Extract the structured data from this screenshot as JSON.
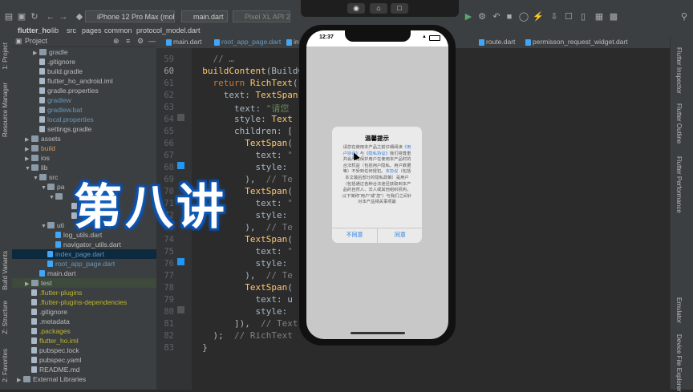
{
  "window": {
    "title": "flutte"
  },
  "toolbar": {
    "device_selector": "iPhone 12 Pro Max (mobile)",
    "run_config": "main.dart",
    "emulator": "Pixel XL API 27"
  },
  "breadcrumb": [
    "flutter_ho",
    "lib",
    "src",
    "pages",
    "common",
    "protocol_model.dart"
  ],
  "left_strip": {
    "project_tab": "1: Project",
    "resource_manager_tab": "Resource Manager",
    "build_variants_tab": "Build Variants",
    "structure_tab": "Z: Structure",
    "favorites_tab": "2: Favorites"
  },
  "project_panel": {
    "title": "Project",
    "rows": [
      {
        "label": "gradle",
        "type": "folder",
        "indent": 3,
        "arrow": "▶",
        "color": "#a9b7c6"
      },
      {
        "label": ".gitignore",
        "type": "file",
        "indent": 3,
        "arrow": "",
        "color": "#bbbbbb"
      },
      {
        "label": "build.gradle",
        "type": "file",
        "indent": 3,
        "arrow": "",
        "color": "#bbbbbb"
      },
      {
        "label": "flutter_ho_android.iml",
        "type": "file",
        "indent": 3,
        "arrow": "",
        "color": "#bbbbbb"
      },
      {
        "label": "gradle.properties",
        "type": "file",
        "indent": 3,
        "arrow": "",
        "color": "#bbbbbb"
      },
      {
        "label": "gradlew",
        "type": "file",
        "indent": 3,
        "arrow": "",
        "color": "#6897bb"
      },
      {
        "label": "gradlew.bat",
        "type": "file",
        "indent": 3,
        "arrow": "",
        "color": "#6897bb"
      },
      {
        "label": "local.properties",
        "type": "file",
        "indent": 3,
        "arrow": "",
        "color": "#6897bb"
      },
      {
        "label": "settings.gradle",
        "type": "file",
        "indent": 3,
        "arrow": "",
        "color": "#bbbbbb"
      },
      {
        "label": "assets",
        "type": "folder",
        "indent": 2,
        "arrow": "▶",
        "color": "#bbbbbb"
      },
      {
        "label": "build",
        "type": "folder",
        "indent": 2,
        "arrow": "▶",
        "color": "#d19a66"
      },
      {
        "label": "ios",
        "type": "folder",
        "indent": 2,
        "arrow": "▶",
        "color": "#bbbbbb"
      },
      {
        "label": "lib",
        "type": "folder",
        "indent": 2,
        "arrow": "▼",
        "color": "#bbbbbb"
      },
      {
        "label": "src",
        "type": "folder",
        "indent": 3,
        "arrow": "▼",
        "color": "#bbbbbb"
      },
      {
        "label": "pa",
        "type": "folder",
        "indent": 4,
        "arrow": "▼",
        "color": "#bbbbbb"
      },
      {
        "label": "",
        "type": "folder",
        "indent": 5,
        "arrow": "▼",
        "color": "#bbbbbb"
      },
      {
        "label": "ast",
        "type": "file",
        "indent": 7,
        "arrow": "",
        "color": "#bbbbbb"
      },
      {
        "label": "",
        "type": "file",
        "indent": 7,
        "arrow": "",
        "color": "#bbbbbb"
      },
      {
        "label": "uti",
        "type": "folder",
        "indent": 4,
        "arrow": "▼",
        "color": "#bbbbbb"
      },
      {
        "label": "log_utils.dart",
        "type": "dart",
        "indent": 5,
        "arrow": "",
        "color": "#bbbbbb"
      },
      {
        "label": "navigator_utils.dart",
        "type": "dart",
        "indent": 5,
        "arrow": "",
        "color": "#bbbbbb"
      },
      {
        "label": "index_page.dart",
        "type": "dart",
        "indent": 4,
        "arrow": "",
        "color": "#6897bb",
        "selected": true
      },
      {
        "label": "root_app_page.dart",
        "type": "dart",
        "indent": 4,
        "arrow": "",
        "color": "#6897bb"
      },
      {
        "label": "main.dart",
        "type": "dart",
        "indent": 3,
        "arrow": "",
        "color": "#bbbbbb"
      },
      {
        "label": "test",
        "type": "folder",
        "indent": 2,
        "arrow": "▶",
        "color": "#bbbbbb",
        "highlight": true
      },
      {
        "label": ".flutter-plugins",
        "type": "file",
        "indent": 2,
        "arrow": "",
        "color": "#bbb529"
      },
      {
        "label": ".flutter-plugins-dependencies",
        "type": "file",
        "indent": 2,
        "arrow": "",
        "color": "#bbb529"
      },
      {
        "label": ".gitignore",
        "type": "file",
        "indent": 2,
        "arrow": "",
        "color": "#bbbbbb"
      },
      {
        "label": ".metadata",
        "type": "file",
        "indent": 2,
        "arrow": "",
        "color": "#bbbbbb"
      },
      {
        "label": ".packages",
        "type": "file",
        "indent": 2,
        "arrow": "",
        "color": "#bbb529"
      },
      {
        "label": "flutter_ho.iml",
        "type": "file",
        "indent": 2,
        "arrow": "",
        "color": "#bbb529"
      },
      {
        "label": "pubspec.lock",
        "type": "file",
        "indent": 2,
        "arrow": "",
        "color": "#bbbbbb"
      },
      {
        "label": "pubspec.yaml",
        "type": "file",
        "indent": 2,
        "arrow": "",
        "color": "#bbbbbb"
      },
      {
        "label": "README.md",
        "type": "file",
        "indent": 2,
        "arrow": "",
        "color": "#bbbbbb"
      },
      {
        "label": "External Libraries",
        "type": "folder",
        "indent": 1,
        "arrow": "▶",
        "color": "#bbbbbb"
      }
    ]
  },
  "tabs": [
    "main.dart",
    "root_app_page.dart",
    "in",
    "route.dart",
    "permisson_request_widget.dart"
  ],
  "editor": {
    "line_numbers": [
      "59",
      "60",
      "61",
      "62",
      "63",
      "64",
      "65",
      "66",
      "67",
      "68",
      "69",
      "70",
      "71",
      "72",
      "73",
      "74",
      "75",
      "76",
      "77",
      "78",
      "79",
      "80",
      "81",
      "82",
      "83"
    ],
    "lines": [
      [
        {
          "t": "    ",
          "c": "prop"
        },
        {
          "t": "// …",
          "c": "cm"
        }
      ],
      [
        {
          "t": "  ",
          "c": "prop"
        },
        {
          "t": "buildContent",
          "c": "fn"
        },
        {
          "t": "(BuildC",
          "c": "prop"
        }
      ],
      [
        {
          "t": "    ",
          "c": "prop"
        },
        {
          "t": "return ",
          "c": "kw"
        },
        {
          "t": "RichText",
          "c": "cls"
        },
        {
          "t": "(",
          "c": "prop"
        }
      ],
      [
        {
          "t": "      text: ",
          "c": "prop"
        },
        {
          "t": "TextSpan",
          "c": "cls"
        },
        {
          "t": "(",
          "c": "prop"
        }
      ],
      [
        {
          "t": "        text: ",
          "c": "prop"
        },
        {
          "t": "\"请您",
          "c": "str"
        }
      ],
      [
        {
          "t": "        style: ",
          "c": "prop"
        },
        {
          "t": "Text",
          "c": "cls"
        }
      ],
      [
        {
          "t": "        children: [",
          "c": "prop"
        }
      ],
      [
        {
          "t": "          ",
          "c": "prop"
        },
        {
          "t": "TextSpan",
          "c": "cls"
        },
        {
          "t": "(",
          "c": "prop"
        }
      ],
      [
        {
          "t": "            text: ",
          "c": "prop"
        },
        {
          "t": "\"",
          "c": "str"
        }
      ],
      [
        {
          "t": "            style:",
          "c": "prop"
        }
      ],
      [
        {
          "t": "          ),  ",
          "c": "prop"
        },
        {
          "t": "// Te",
          "c": "cm"
        }
      ],
      [
        {
          "t": "          ",
          "c": "prop"
        },
        {
          "t": "TextSpan",
          "c": "cls"
        },
        {
          "t": "(",
          "c": "prop"
        }
      ],
      [
        {
          "t": "            text: ",
          "c": "prop"
        },
        {
          "t": "\"",
          "c": "str"
        }
      ],
      [
        {
          "t": "            style:",
          "c": "prop"
        },
        {
          "t": "                         ]),",
          "c": "prop"
        }
      ],
      [
        {
          "t": "          ),  ",
          "c": "prop"
        },
        {
          "t": "// Te",
          "c": "cm"
        }
      ],
      [
        {
          "t": "          ",
          "c": "prop"
        },
        {
          "t": "TextSpan",
          "c": "cls"
        },
        {
          "t": "(",
          "c": "prop"
        }
      ],
      [
        {
          "t": "            text: ",
          "c": "prop"
        },
        {
          "t": "\"",
          "c": "str"
        }
      ],
      [
        {
          "t": "            style:",
          "c": "prop"
        }
      ],
      [
        {
          "t": "          ),  ",
          "c": "prop"
        },
        {
          "t": "// Te",
          "c": "cm"
        }
      ],
      [
        {
          "t": "          ",
          "c": "prop"
        },
        {
          "t": "TextSpan",
          "c": "cls"
        },
        {
          "t": "(",
          "c": "prop"
        }
      ],
      [
        {
          "t": "            text: u",
          "c": "prop"
        }
      ],
      [
        {
          "t": "            style:",
          "c": "prop"
        },
        {
          "t": "                         ]),",
          "c": "prop"
        }
      ],
      [
        {
          "t": "        ]),  ",
          "c": "prop"
        },
        {
          "t": "// Text",
          "c": "cm"
        }
      ],
      [
        {
          "t": "    );  ",
          "c": "prop"
        },
        {
          "t": "// RichText",
          "c": "cm"
        }
      ],
      [
        {
          "t": "  }",
          "c": "prop"
        }
      ]
    ]
  },
  "right_strip": {
    "inspector": "Flutter Inspector",
    "outline": "Flutter Outline",
    "performance": "Flutter Performance",
    "emulator": "Emulator",
    "device_explorer": "Device File Explorer"
  },
  "simulator": {
    "status_time": "12:37",
    "dialog": {
      "title": "温馨提示",
      "body_before": "请您在使用本产品之前仔细阅读",
      "user_agreement": "《用户协议》",
      "and": "与",
      "privacy": "《隐私协议》",
      "body_after": "我们将尊重并会严格保护用户在使用本产品时的合法权益（包括用户隐私、用户数据等）不受到任何侵犯。",
      "agreement_word": "本协议",
      "body_tail": "（包括本文最后部分的隐私政策）是用户（包括通过各种合法途径获取到本产品的自然人、法人或其他组织机构，以下简称“用户”或“您”）与我们之间针对本产品相关事项最",
      "disagree": "不同意",
      "agree": "同意"
    }
  },
  "overlay": {
    "text": "第八讲"
  }
}
